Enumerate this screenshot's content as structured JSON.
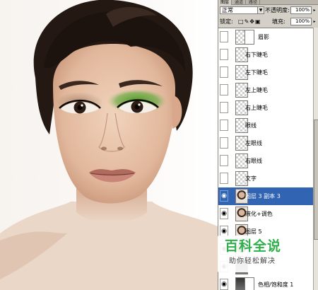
{
  "panel": {
    "tabs": [
      "图层",
      "通道",
      "路径"
    ],
    "blend_mode": "正常",
    "opacity_label": "不透明度:",
    "opacity_value": "100%",
    "lock_label": "锁定:",
    "fill_label": "填充:",
    "fill_value": "100%"
  },
  "layers": [
    {
      "name": "眉影",
      "visible": false,
      "thumb": "transparent",
      "has_mask": true
    },
    {
      "name": "右下睫毛",
      "visible": false,
      "thumb": "transparent"
    },
    {
      "name": "左下睫毛",
      "visible": false,
      "thumb": "transparent"
    },
    {
      "name": "左上睫毛",
      "visible": false,
      "thumb": "transparent"
    },
    {
      "name": "右上睫毛",
      "visible": false,
      "thumb": "transparent"
    },
    {
      "name": "眼线",
      "visible": false,
      "thumb": "transparent"
    },
    {
      "name": "左眼线",
      "visible": false,
      "thumb": "transparent"
    },
    {
      "name": "右眼线",
      "visible": false,
      "thumb": "transparent"
    },
    {
      "name": "文字",
      "visible": false,
      "thumb": "transparent"
    },
    {
      "name": "图层 3 副本 3",
      "visible": true,
      "thumb": "photo",
      "selected": true
    },
    {
      "name": "液化+调色",
      "visible": true,
      "thumb": "photo"
    },
    {
      "name": "图层 5",
      "visible": true,
      "thumb": "photo"
    },
    {
      "name": "",
      "visible": true,
      "thumb": "photo"
    },
    {
      "name": "",
      "visible": true,
      "thumb": "dark"
    },
    {
      "name": "色相/饱和度 1",
      "visible": true,
      "thumb": "dark",
      "has_mask": true
    }
  ],
  "watermark": {
    "logo": "百科全说",
    "tagline": "助你轻松解决"
  },
  "colors": {
    "selection": "#3165b4",
    "panel_bg": "#d4d0c8",
    "watermark_green": "#2db04b",
    "eyeshadow": "#4f9a2c"
  }
}
